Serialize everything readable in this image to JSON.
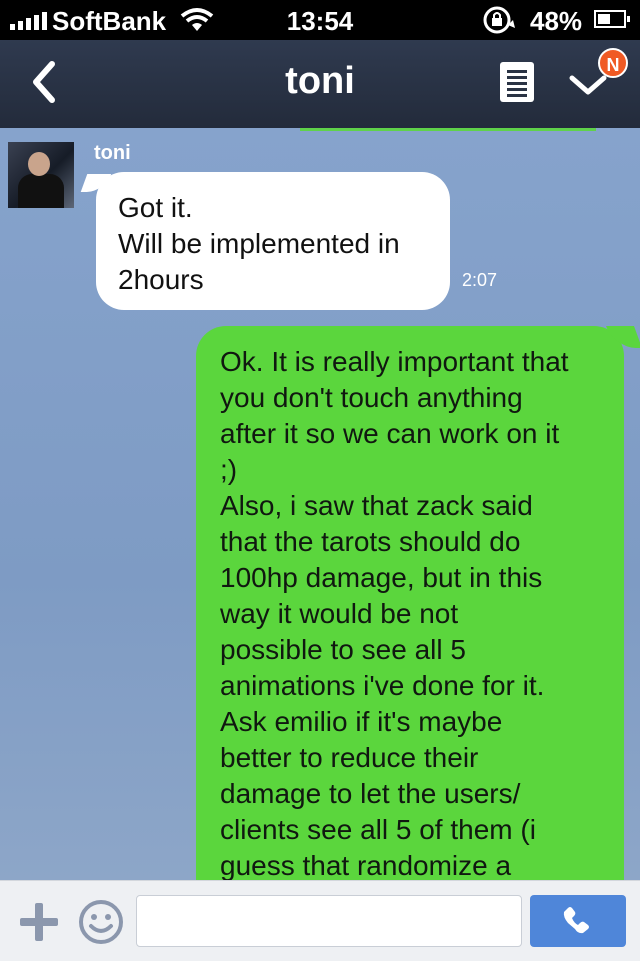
{
  "status_bar": {
    "carrier": "SoftBank",
    "time": "13:54",
    "battery_percent": "48%",
    "battery_level": 0.48
  },
  "navbar": {
    "title": "toni",
    "notification_badge": "N",
    "icons": [
      "back-chevron-icon",
      "notes-icon",
      "chevron-down-icon"
    ]
  },
  "messages": {
    "incoming": {
      "sender": "toni",
      "text": "Got it.\nWill be implemented in\n2hours",
      "time": "2:07"
    },
    "outgoing": {
      "text": "Ok. It is really important that\nyou don't touch anything\nafter it so we can work on it\n;)\nAlso, i saw that zack said\nthat the tarots should do\n100hp damage, but in this\nway it would be not\npossible to see all 5\nanimations i've done for it.\nAsk emilio if it's maybe\nbetter to reduce their\ndamage to let the users/\nclients see all 5 of them (i\nguess that randomize a"
    }
  },
  "input_bar": {
    "placeholder": "",
    "icons": [
      "plus-icon",
      "smiley-icon",
      "phone-icon"
    ]
  },
  "colors": {
    "navbar": "#2a3344",
    "outgoing_bubble": "#5bd63d",
    "incoming_bubble": "#ffffff",
    "call_button": "#4f86d9",
    "badge": "#f05a24"
  }
}
